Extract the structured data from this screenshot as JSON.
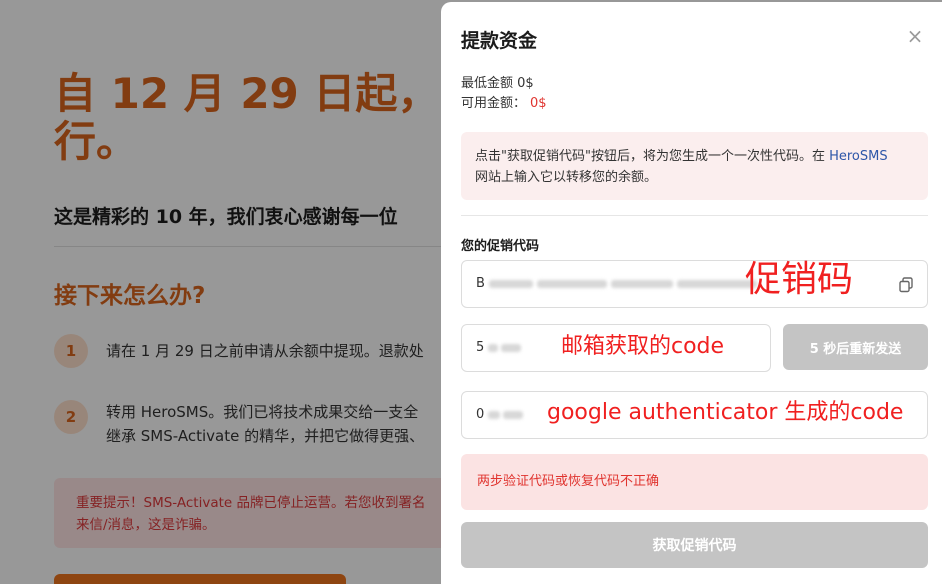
{
  "background": {
    "title_line1": "自 12 月 29 日起，",
    "title_line2": "行。",
    "subtitle": "这是精彩的 10 年，我们衷心感谢每一位",
    "section_title": "接下来怎么办?",
    "steps": [
      {
        "num": "1",
        "text": "请在 1 月 29 日之前申请从余额中提现。退款处"
      },
      {
        "num": "2",
        "text_line1": "转用 HeroSMS。我们已将技术成果交给一支全",
        "text_line2": "继承 SMS-Activate 的精华，并把它做得更强、"
      }
    ],
    "warning_line1": "重要提示！SMS-Activate 品牌已停止运营。若您收到署名",
    "warning_line2": "来信/消息，这是诈骗。"
  },
  "modal": {
    "title": "提款资金",
    "close_icon": "×",
    "min_amount": "最低金额 0$",
    "available_label": "可用金额：",
    "available_value": "0$",
    "notice_part1": "点击\"获取促销代码\"按钮后，将为您生成一个一次性代码。在 ",
    "notice_brand": "HeroSMS",
    "notice_part2": "网站上输入它以转移您的余额。",
    "promo_label": "您的促销代码",
    "promo_prefix": "B",
    "email_prefix": "5",
    "ga_prefix": "0",
    "resend_label": "5 秒后重新发送",
    "error_text": "两步验证代码或恢复代码不正确",
    "submit_label": "获取促销代码"
  },
  "annotations": {
    "promo": "促销码",
    "email": "邮箱获取的code",
    "ga": "google authenticator 生成的code"
  },
  "colors": {
    "brand_orange": "#d2621c",
    "error_red": "#e0342f",
    "annotation_red": "#f02020",
    "disabled_gray": "#c4c4c4",
    "link_blue": "#2e56a8"
  },
  "icons": {
    "copy": "copy-icon",
    "close": "close-icon"
  }
}
